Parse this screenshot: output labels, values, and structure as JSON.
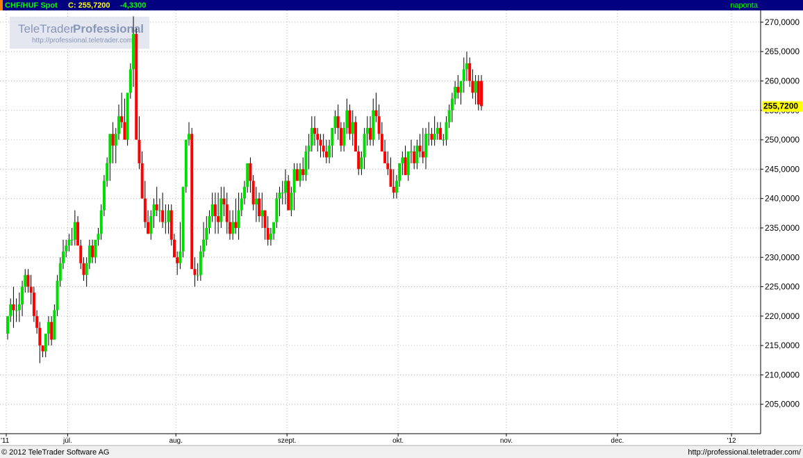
{
  "header": {
    "symbol": "CHF/HUF Spot",
    "close_text": "C: 255,7200",
    "change": "-4,3300",
    "period": "naponta"
  },
  "watermark": {
    "brand": "TeleTrader",
    "product": "Professional",
    "url": "http://professional.teletrader.com/"
  },
  "footer": {
    "copyright": "© 2012 TeleTrader Software AG",
    "url": "http://professional.teletrader.com/"
  },
  "last_price_label": "255,7200",
  "colors": {
    "header_bg": "#000080",
    "up": "#00dd00",
    "down": "#ff0000",
    "wick": "#000000",
    "grid": "#b4b4b4",
    "axis_bg": "#ffffff",
    "last_label_bg": "#ffff00"
  },
  "chart_data": {
    "type": "candlestick",
    "title": "CHF/HUF Spot",
    "ylim": [
      200,
      272
    ],
    "y_ticks": [
      205,
      210,
      215,
      220,
      225,
      230,
      235,
      240,
      245,
      250,
      255,
      260,
      265,
      270
    ],
    "y_tick_labels": [
      "205,0000",
      "210,0000",
      "215,0000",
      "220,0000",
      "225,0000",
      "230,0000",
      "235,0000",
      "240,0000",
      "245,0000",
      "250,0000",
      "255,0000",
      "260,0000",
      "265,0000",
      "270,0000"
    ],
    "x_labels": [
      {
        "label": "'11",
        "index": 0
      },
      {
        "label": "júl.",
        "index": 21
      },
      {
        "label": "aug.",
        "index": 58
      },
      {
        "label": "szept.",
        "index": 96
      },
      {
        "label": "okt.",
        "index": 134
      },
      {
        "label": "nov.",
        "index": 171
      },
      {
        "label": "dec.",
        "index": 209
      },
      {
        "label": "'12",
        "index": 248
      }
    ],
    "grid": true,
    "ohlc": [
      [
        217,
        220,
        216,
        220
      ],
      [
        220,
        223,
        219,
        222
      ],
      [
        222,
        225,
        218,
        221
      ],
      [
        221,
        223,
        219,
        221
      ],
      [
        221,
        224,
        219,
        222
      ],
      [
        222,
        226,
        220,
        225
      ],
      [
        225,
        228,
        224,
        227
      ],
      [
        227,
        228,
        224,
        225
      ],
      [
        225,
        227,
        222,
        224
      ],
      [
        224,
        225,
        219,
        220
      ],
      [
        220,
        221,
        217,
        218
      ],
      [
        218,
        219,
        212,
        215
      ],
      [
        215,
        215,
        213,
        214
      ],
      [
        214,
        217,
        213,
        217
      ],
      [
        217,
        220,
        215,
        219
      ],
      [
        219,
        220,
        215,
        216
      ],
      [
        216,
        222,
        216,
        221
      ],
      [
        221,
        227,
        220,
        226
      ],
      [
        226,
        230,
        225,
        229
      ],
      [
        229,
        233,
        228,
        231
      ],
      [
        231,
        233,
        230,
        232
      ],
      [
        232,
        234,
        231,
        233
      ],
      [
        233,
        235,
        232,
        233
      ],
      [
        233,
        238,
        232,
        236
      ],
      [
        236,
        237,
        232,
        232
      ],
      [
        232,
        233,
        228,
        229
      ],
      [
        229,
        230,
        226,
        227
      ],
      [
        227,
        230,
        225,
        229
      ],
      [
        229,
        233,
        228,
        232
      ],
      [
        232,
        233,
        229,
        230
      ],
      [
        230,
        232,
        229,
        233
      ],
      [
        233,
        235,
        232,
        234
      ],
      [
        234,
        239,
        233,
        238
      ],
      [
        238,
        244,
        237,
        243
      ],
      [
        243,
        247,
        242,
        246
      ],
      [
        246,
        250,
        243,
        251
      ],
      [
        251,
        253,
        246,
        249
      ],
      [
        249,
        252,
        246,
        251
      ],
      [
        251,
        256,
        250,
        254
      ],
      [
        254,
        258,
        252,
        253
      ],
      [
        253,
        257,
        251,
        250
      ],
      [
        250,
        257,
        249,
        258
      ],
      [
        258,
        263,
        257,
        262
      ],
      [
        262,
        271,
        259,
        268
      ],
      [
        268,
        269,
        262,
        250
      ],
      [
        250,
        254,
        245,
        246
      ],
      [
        246,
        248,
        242,
        240
      ],
      [
        240,
        243,
        235,
        236
      ],
      [
        236,
        238,
        234,
        234
      ],
      [
        234,
        238,
        233,
        237
      ],
      [
        237,
        240,
        235,
        239
      ],
      [
        239,
        242,
        237,
        238
      ],
      [
        238,
        240,
        236,
        238
      ],
      [
        238,
        241,
        235,
        236
      ],
      [
        236,
        239,
        234,
        236
      ],
      [
        236,
        239,
        234,
        238
      ],
      [
        238,
        239,
        232,
        233
      ],
      [
        233,
        234,
        230,
        230
      ],
      [
        230,
        231,
        227,
        229
      ],
      [
        229,
        236,
        228,
        231
      ],
      [
        231,
        242,
        230,
        242
      ],
      [
        242,
        249,
        241,
        250
      ],
      [
        250,
        253,
        249,
        251
      ],
      [
        251,
        252,
        228,
        228
      ],
      [
        228,
        230,
        225,
        227
      ],
      [
        227,
        229,
        226,
        227
      ],
      [
        227,
        232,
        226,
        231
      ],
      [
        231,
        236,
        230,
        233
      ],
      [
        233,
        237,
        232,
        235
      ],
      [
        235,
        238,
        234,
        237
      ],
      [
        237,
        241,
        236,
        239
      ],
      [
        239,
        241,
        234,
        237
      ],
      [
        237,
        241,
        234,
        236
      ],
      [
        236,
        242,
        235,
        240
      ],
      [
        240,
        242,
        237,
        239
      ],
      [
        239,
        241,
        234,
        236
      ],
      [
        236,
        238,
        233,
        234
      ],
      [
        234,
        238,
        233,
        236
      ],
      [
        236,
        240,
        234,
        235
      ],
      [
        235,
        241,
        233,
        238
      ],
      [
        238,
        241,
        237,
        240
      ],
      [
        240,
        243,
        239,
        242
      ],
      [
        242,
        246,
        241,
        246
      ],
      [
        246,
        247,
        241,
        243
      ],
      [
        243,
        244,
        238,
        239
      ],
      [
        239,
        242,
        236,
        240
      ],
      [
        240,
        241,
        236,
        237
      ],
      [
        237,
        241,
        235,
        238
      ],
      [
        238,
        238,
        233,
        235
      ],
      [
        235,
        237,
        232,
        233
      ],
      [
        233,
        235,
        232,
        234
      ],
      [
        234,
        236,
        233,
        236
      ],
      [
        236,
        241,
        235,
        240
      ],
      [
        240,
        242,
        237,
        241
      ],
      [
        241,
        243,
        239,
        241
      ],
      [
        241,
        245,
        239,
        243
      ],
      [
        243,
        244,
        239,
        238
      ],
      [
        238,
        242,
        237,
        241
      ],
      [
        241,
        246,
        238,
        245
      ],
      [
        245,
        246,
        243,
        243
      ],
      [
        243,
        246,
        242,
        245
      ],
      [
        245,
        247,
        243,
        244
      ],
      [
        244,
        249,
        243,
        248
      ],
      [
        248,
        251,
        245,
        249
      ],
      [
        249,
        254,
        248,
        252
      ],
      [
        252,
        254,
        249,
        251
      ],
      [
        251,
        252,
        248,
        250
      ],
      [
        250,
        251,
        247,
        249
      ],
      [
        249,
        251,
        247,
        248
      ],
      [
        248,
        250,
        246,
        247
      ],
      [
        247,
        250,
        246,
        249
      ],
      [
        249,
        252,
        247,
        252
      ],
      [
        252,
        255,
        251,
        254
      ],
      [
        254,
        256,
        250,
        252
      ],
      [
        252,
        253,
        248,
        249
      ],
      [
        249,
        253,
        248,
        252
      ],
      [
        252,
        257,
        251,
        255
      ],
      [
        255,
        256,
        250,
        251
      ],
      [
        251,
        255,
        249,
        253
      ],
      [
        253,
        254,
        248,
        248
      ],
      [
        248,
        249,
        244,
        245
      ],
      [
        245,
        248,
        244,
        247
      ],
      [
        247,
        252,
        245,
        251
      ],
      [
        251,
        254,
        249,
        252
      ],
      [
        252,
        254,
        249,
        250
      ],
      [
        250,
        257,
        249,
        255
      ],
      [
        255,
        258,
        253,
        254
      ],
      [
        254,
        256,
        250,
        251
      ],
      [
        251,
        253,
        248,
        248
      ],
      [
        248,
        250,
        246,
        246
      ],
      [
        246,
        248,
        244,
        245
      ],
      [
        245,
        247,
        242,
        242
      ],
      [
        242,
        245,
        240,
        241
      ],
      [
        241,
        244,
        240,
        243
      ],
      [
        243,
        246,
        242,
        246
      ],
      [
        246,
        248,
        244,
        247
      ],
      [
        247,
        249,
        244,
        244
      ],
      [
        244,
        248,
        243,
        248
      ],
      [
        248,
        250,
        246,
        248
      ],
      [
        248,
        249,
        245,
        246
      ],
      [
        246,
        250,
        245,
        249
      ],
      [
        249,
        251,
        247,
        248
      ],
      [
        248,
        252,
        246,
        247
      ],
      [
        247,
        252,
        245,
        251
      ],
      [
        251,
        253,
        249,
        251
      ],
      [
        251,
        252,
        249,
        250
      ],
      [
        250,
        254,
        249,
        251
      ],
      [
        251,
        253,
        250,
        252
      ],
      [
        252,
        253,
        250,
        250
      ],
      [
        250,
        251,
        249,
        250
      ],
      [
        250,
        254,
        249,
        253
      ],
      [
        253,
        256,
        252,
        255
      ],
      [
        255,
        258,
        253,
        257
      ],
      [
        257,
        260,
        256,
        259
      ],
      [
        259,
        261,
        257,
        258
      ],
      [
        258,
        260,
        256,
        260
      ],
      [
        260,
        264,
        258,
        262
      ],
      [
        262,
        265,
        260,
        263
      ],
      [
        263,
        264,
        259,
        260
      ],
      [
        260,
        262,
        257,
        258
      ],
      [
        258,
        261,
        256,
        260
      ],
      [
        260,
        261,
        255,
        256
      ],
      [
        260,
        261,
        255,
        255.72
      ]
    ]
  }
}
